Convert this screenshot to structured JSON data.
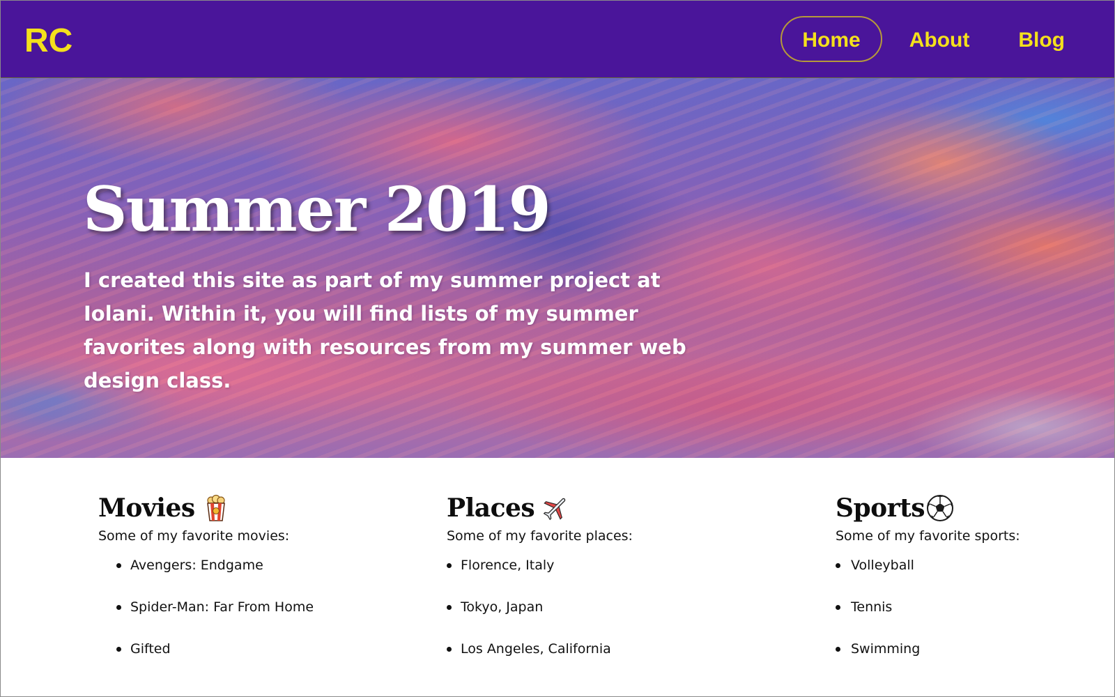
{
  "nav": {
    "logo": "RC",
    "links": [
      {
        "label": "Home",
        "active": true
      },
      {
        "label": "About",
        "active": false
      },
      {
        "label": "Blog",
        "active": false
      }
    ]
  },
  "hero": {
    "title": "Summer 2019",
    "text": "I created this site as part of my summer project at Iolani. Within it, you will find lists of my summer favorites along with resources from my summer web design class."
  },
  "favorites": {
    "movies": {
      "heading": "Movies",
      "icon": "popcorn-icon",
      "description": "Some of my favorite movies:",
      "items": [
        "Avengers: Endgame",
        "Spider-Man: Far From Home",
        "Gifted"
      ]
    },
    "places": {
      "heading": "Places",
      "icon": "airplane-icon",
      "description": "Some of my favorite places:",
      "items": [
        "Florence, Italy",
        "Tokyo, Japan",
        "Los Angeles, California"
      ]
    },
    "sports": {
      "heading": "Sports",
      "icon": "soccer-ball-icon",
      "description": "Some of my favorite sports:",
      "items": [
        "Volleyball",
        "Tennis",
        "Swimming"
      ]
    }
  },
  "colors": {
    "nav_background": "#4a159a",
    "nav_text": "#f4e01c",
    "hero_text": "#ffffff",
    "body_text": "#111111"
  }
}
